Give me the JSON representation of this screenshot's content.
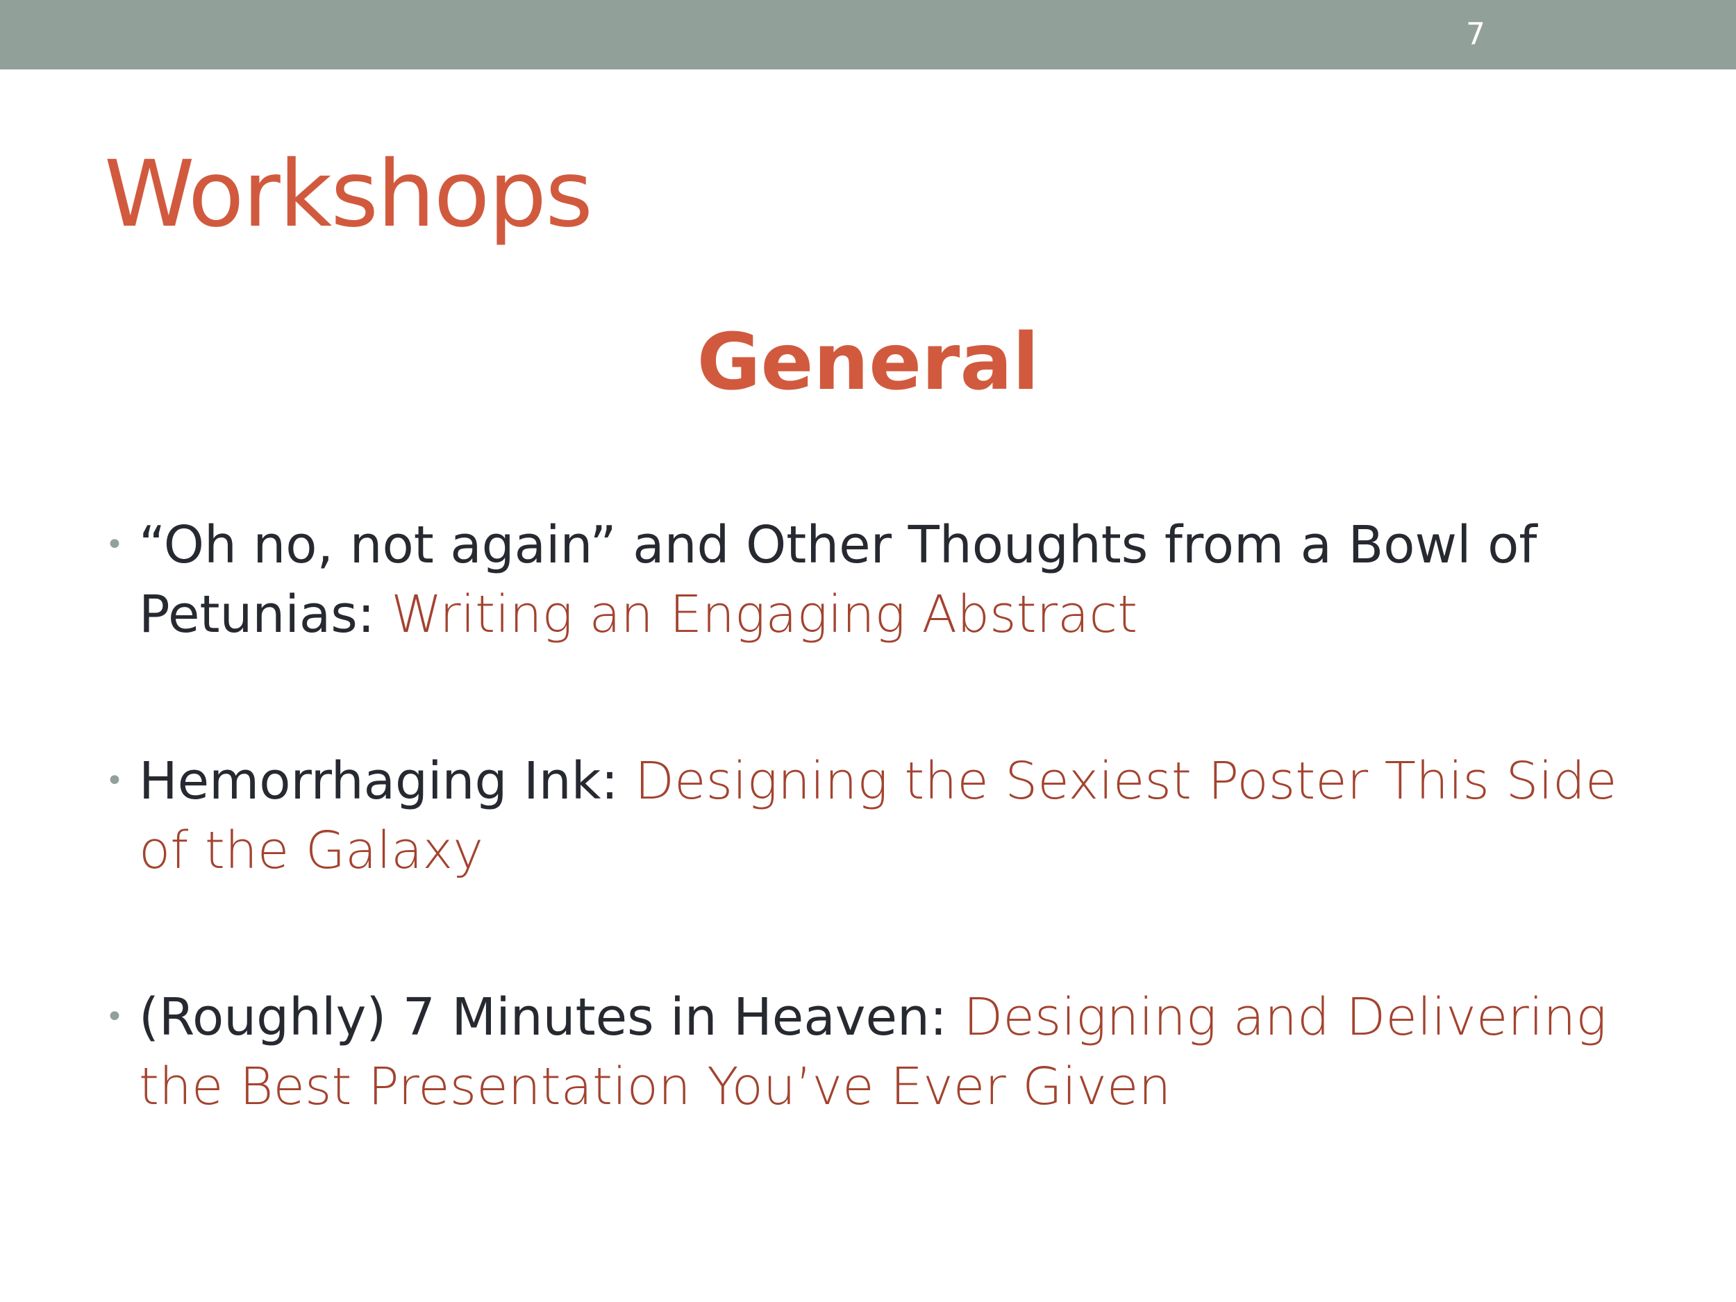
{
  "slide": {
    "number": "7",
    "title": "Workshops",
    "section_heading": "General"
  },
  "workshops": [
    {
      "lead": "“Oh no, not again” and Other Thoughts from a Bowl of Petunias: ",
      "topic": "Writing an Engaging Abstract"
    },
    {
      "lead": "Hemorrhaging Ink: ",
      "topic": "Designing the Sexiest Poster This Side of the Galaxy"
    },
    {
      "lead": "(Roughly) 7 Minutes in Heaven: ",
      "topic": "Designing and Delivering the Best Presentation You’ve Ever Given"
    }
  ],
  "colors": {
    "top_bar": "#91a19a",
    "title": "#d15a3e",
    "body_text": "#262930",
    "topic_text": "#a3432f",
    "bullet": "#91a19a"
  },
  "icons": {
    "bullet": "bullet-dot-icon"
  }
}
